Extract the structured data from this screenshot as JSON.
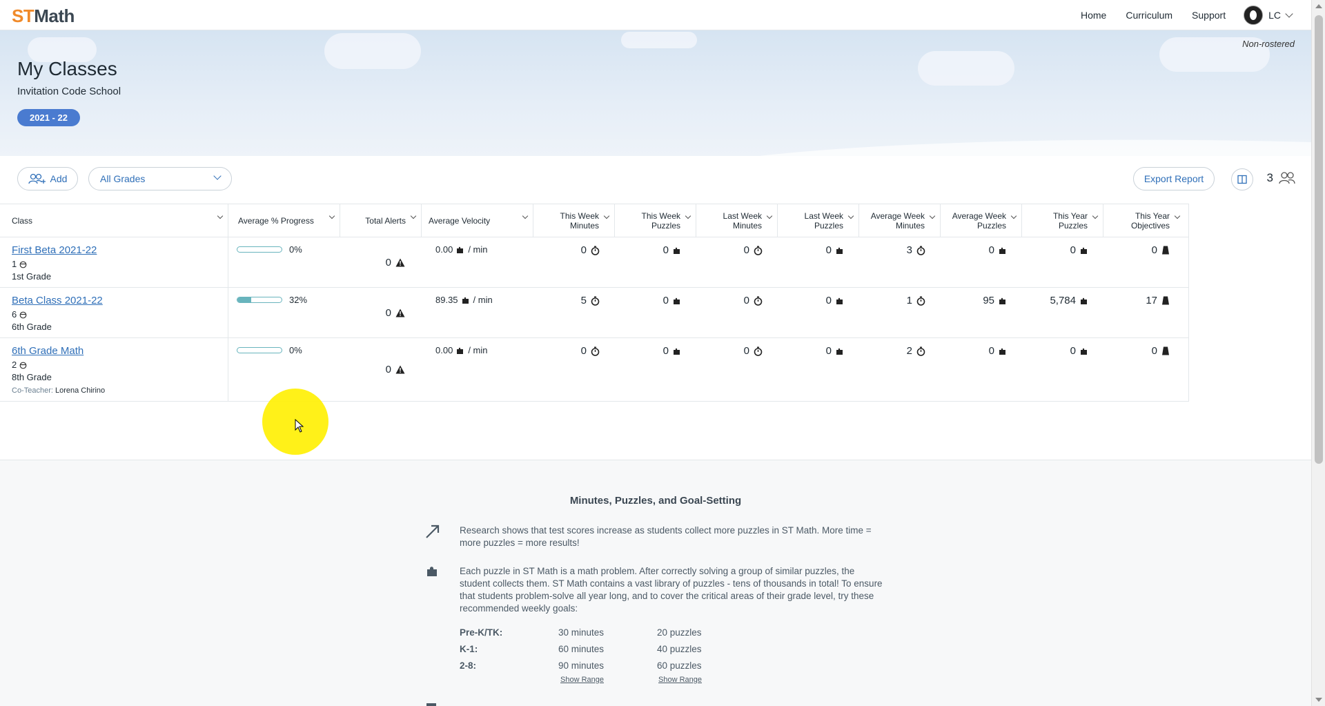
{
  "brand": {
    "logo_st": "ST",
    "logo_math": "Math"
  },
  "nav": {
    "home": "Home",
    "curriculum": "Curriculum",
    "support": "Support",
    "user_initials": "LC"
  },
  "hero": {
    "title": "My Classes",
    "school": "Invitation Code School",
    "year": "2021 - 22",
    "roster_status": "Non-rostered"
  },
  "toolbar": {
    "add_label": "Add",
    "grade_filter": "All Grades",
    "export_label": "Export Report",
    "class_count": "3"
  },
  "table": {
    "headers": [
      "Class",
      "Average % Progress",
      "Total Alerts",
      "Average Velocity",
      "This Week Minutes",
      "This Week Puzzles",
      "Last Week Minutes",
      "Last Week Puzzles",
      "Average Week Minutes",
      "Average Week Puzzles",
      "This Year Puzzles",
      "This Year Objectives"
    ],
    "rows": [
      {
        "name": "First Beta 2021-22",
        "students": "1",
        "grade": "1st Grade",
        "progress_label": "0%",
        "progress": 0,
        "alerts": "0",
        "velocity": "0.00",
        "velocity_unit": "/ min",
        "tw_min": "0",
        "tw_puz": "0",
        "lw_min": "0",
        "lw_puz": "0",
        "aw_min": "3",
        "aw_puz": "0",
        "ty_puz": "0",
        "ty_obj": "0"
      },
      {
        "name": "Beta Class 2021-22",
        "students": "6",
        "grade": "6th Grade",
        "progress_label": "32%",
        "progress": 0.32,
        "alerts": "0",
        "velocity": "89.35",
        "velocity_unit": "/ min",
        "tw_min": "5",
        "tw_puz": "0",
        "lw_min": "0",
        "lw_puz": "0",
        "aw_min": "1",
        "aw_puz": "95",
        "ty_puz": "5,784",
        "ty_obj": "17"
      },
      {
        "name": "6th Grade Math",
        "students": "2",
        "grade": "8th Grade",
        "progress_label": "0%",
        "progress": 0,
        "alerts": "0",
        "velocity": "0.00",
        "velocity_unit": "/ min",
        "tw_min": "0",
        "tw_puz": "0",
        "lw_min": "0",
        "lw_puz": "0",
        "aw_min": "2",
        "aw_puz": "0",
        "ty_puz": "0",
        "ty_obj": "0",
        "coteacher_label": "Co-Teacher:",
        "coteacher_name": "Lorena Chirino"
      }
    ]
  },
  "info": {
    "title": "Minutes, Puzzles, and Goal-Setting",
    "para1": "Research shows that test scores increase as students collect more puzzles in ST Math. More time = more puzzles = more results!",
    "para2": "Each puzzle in ST Math is a math problem. After correctly solving a group of similar puzzles, the student collects them. ST Math contains a vast library of puzzles - tens of thousands in total! To ensure that students problem-solve all year long, and to cover the critical areas of their grade level, try these recommended weekly goals:",
    "goals": [
      {
        "grade": "Pre-K/TK:",
        "minutes": "30 minutes",
        "puzzles": "20 puzzles"
      },
      {
        "grade": "K-1:",
        "minutes": "60 minutes",
        "puzzles": "40 puzzles"
      },
      {
        "grade": "2-8:",
        "minutes": "90 minutes",
        "puzzles": "60 puzzles"
      }
    ],
    "show_range": "Show Range"
  },
  "colors": {
    "accent": "#2f6fb8",
    "badge": "#4a7bd0",
    "progress": "#68b4bd",
    "logo_orange": "#f08a2a"
  }
}
